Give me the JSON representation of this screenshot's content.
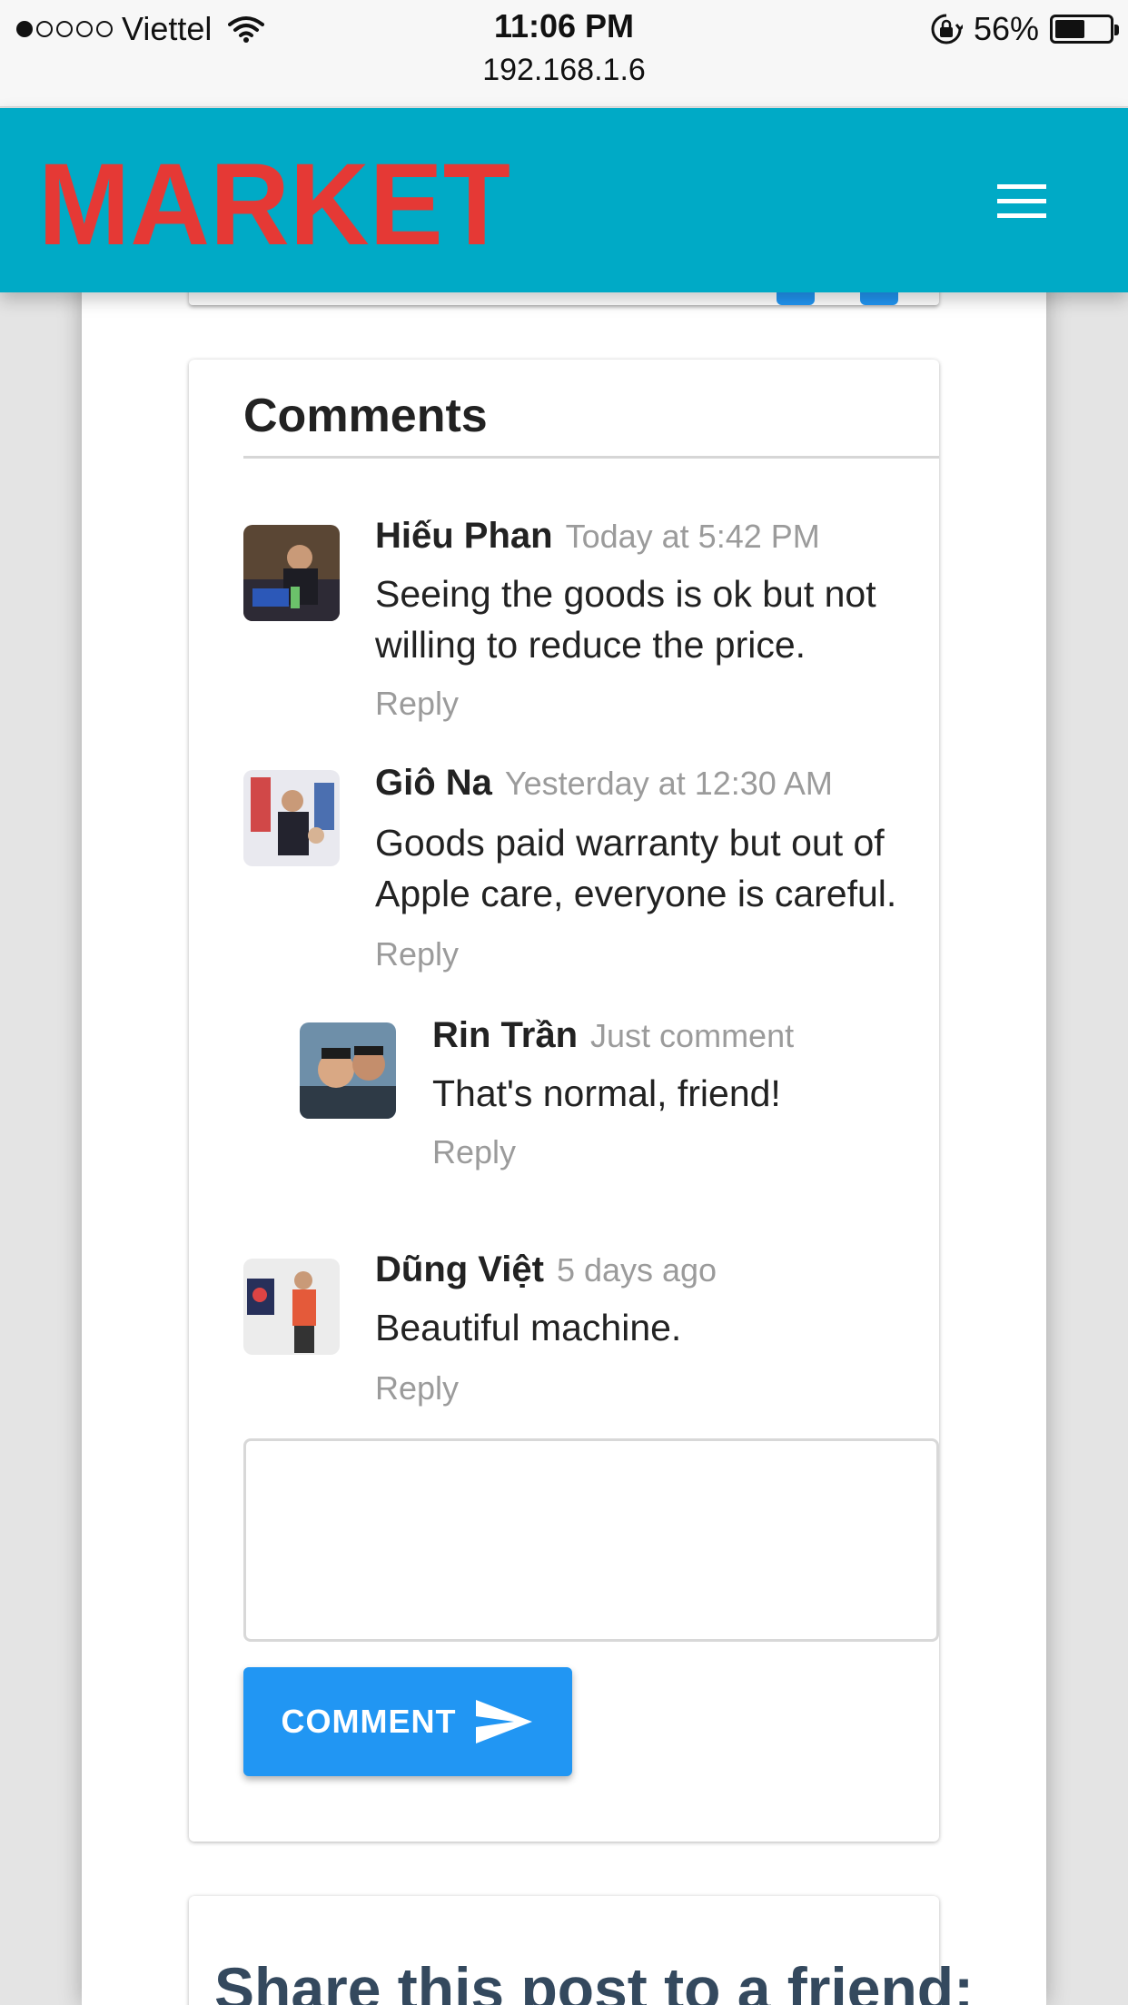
{
  "status_bar": {
    "carrier": "Viettel",
    "signal_bars_filled": 1,
    "signal_bars_total": 5,
    "time": "11:06 PM",
    "url": "192.168.1.6",
    "battery": "56%",
    "battery_level": 0.56
  },
  "header": {
    "logo_text": "MARKET",
    "logo_color": "#e53935",
    "background": "#00aac6",
    "menu_icon": "hamburger-menu-icon"
  },
  "comments_section": {
    "title": "Comments",
    "comments": [
      {
        "name": "Hiếu Phan",
        "time": "Today at 5:42 PM",
        "text": "Seeing the goods is ok but not willing to reduce the price.",
        "reply": "Reply"
      },
      {
        "name": "Giô Na",
        "time": "Yesterday at 12:30 AM",
        "text": "Goods paid warranty but out of Apple care, everyone is careful.",
        "reply": "Reply"
      },
      {
        "name": "Rin Trần",
        "time": "Just comment",
        "text": "That's normal, friend!",
        "reply": "Reply"
      },
      {
        "name": "Dũng Việt",
        "time": "5 days ago",
        "text": "Beautiful machine.",
        "reply": "Reply"
      }
    ],
    "comment_input_placeholder": "",
    "submit_label": "COMMENT",
    "submit_icon": "send-icon",
    "accent": "#2196f3"
  },
  "share": {
    "title": "Share this post to a friend:"
  }
}
